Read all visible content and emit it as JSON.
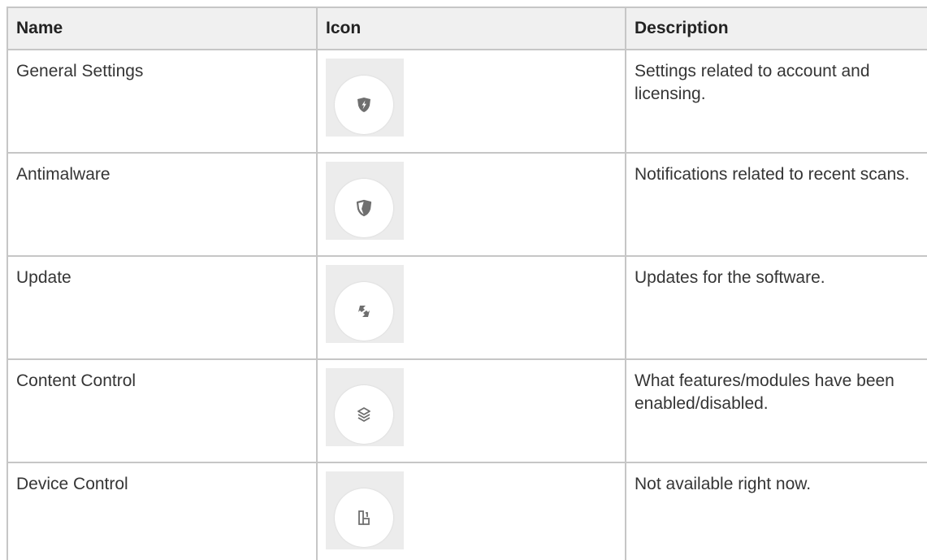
{
  "table": {
    "headers": {
      "name": "Name",
      "icon": "Icon",
      "description": "Description"
    },
    "rows": [
      {
        "name": "General Settings",
        "icon": "shield-bolt-icon",
        "description": "Settings related to account and licensing."
      },
      {
        "name": "Antimalware",
        "icon": "shield-half-icon",
        "description": "Notifications related to recent scans."
      },
      {
        "name": "Update",
        "icon": "update-arrows-icon",
        "description": "Updates for the software."
      },
      {
        "name": "Content Control",
        "icon": "layers-icon",
        "description": "What features/modules have been enabled/disabled."
      },
      {
        "name": "Device Control",
        "icon": "device-icon",
        "description": "Not available right now."
      }
    ]
  },
  "colors": {
    "header_background": "#f0f0f0",
    "border": "#c6c6c6",
    "icon_tile": "#ececec",
    "icon_glyph": "#6f6f6f"
  }
}
